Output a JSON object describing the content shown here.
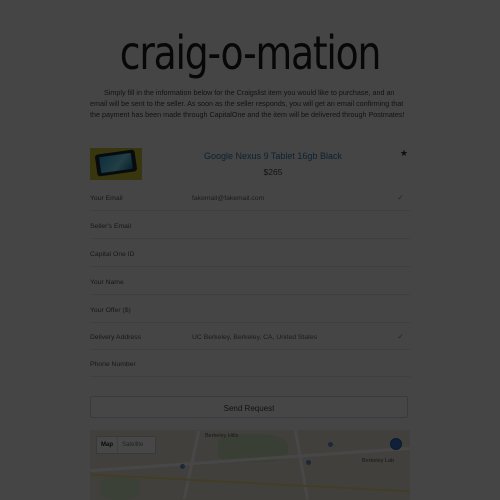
{
  "app": {
    "logo": "craig-o-mation",
    "intro": "Simply fill in the information below for the Craigslist item you would like to purchase, and an email will be sent to the seller. As soon as the seller responds, you will get an email confirming that the payment has been made through CapitalOne and the item will be delivered through Postmates!"
  },
  "product": {
    "title": "Google Nexus 9 Tablet 16gb Black",
    "price": "$265",
    "thumb_icon": "tablet-image",
    "action_icon": "star-icon"
  },
  "form": {
    "rows": [
      {
        "label": "Your Email",
        "value": "fakemail@fakemail.com",
        "has_dropdown": true
      },
      {
        "label": "Seller's Email",
        "value": "",
        "has_dropdown": false
      },
      {
        "label": "Capital One ID",
        "value": "",
        "has_dropdown": false
      },
      {
        "label": "Your Name",
        "value": "",
        "has_dropdown": false
      },
      {
        "label": "Your Offer ($)",
        "value": "",
        "has_dropdown": false
      },
      {
        "label": "Delivery Address",
        "value": "UC Berkeley, Berkeley, CA, United States",
        "has_dropdown": true
      },
      {
        "label": "Phone Number",
        "value": "",
        "has_dropdown": false
      }
    ]
  },
  "actions": {
    "send_label": "Send Request"
  },
  "map": {
    "type_map": "Map",
    "type_satellite": "Satellite",
    "labels": [
      "Berkeley Hills",
      "Berkeley Lab"
    ]
  },
  "overlay": {
    "color": "#000000",
    "opacity": 0.72
  }
}
